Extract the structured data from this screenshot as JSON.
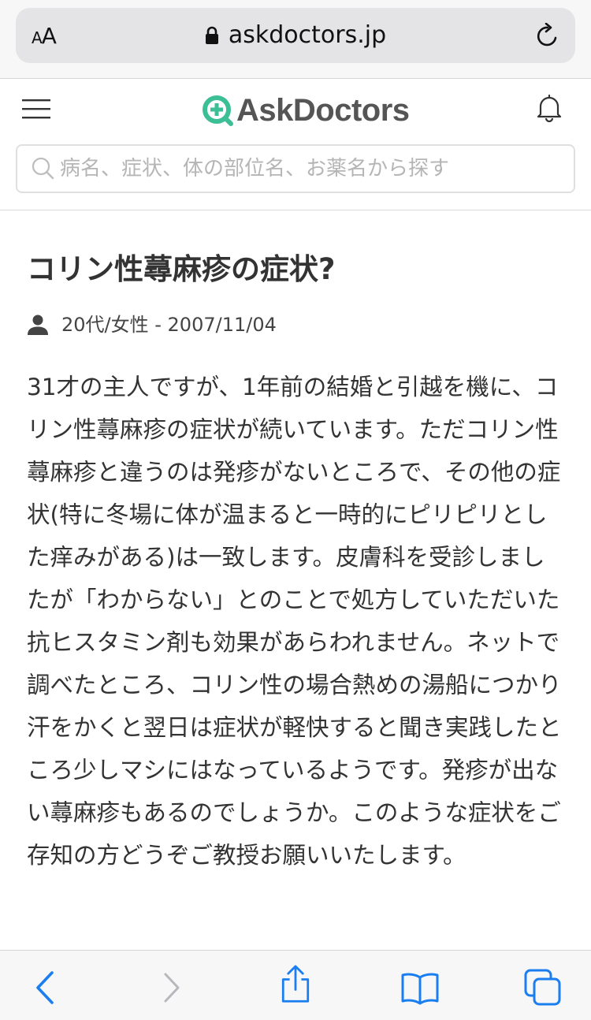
{
  "browser": {
    "aa_small": "A",
    "aa_large": "A",
    "url": "askdoctors.jp"
  },
  "header": {
    "logo_text": "AskDoctors",
    "search_placeholder": "病名、症状、体の部位名、お薬名から探す"
  },
  "question": {
    "title": "コリン性蕁麻疹の症状?",
    "meta": "20代/女性 - 2007/11/04",
    "body": "31才の主人ですが、1年前の結婚と引越を機に、コリン性蕁麻疹の症状が続いています。ただコリン性蕁麻疹と違うのは発疹がないところで、その他の症状(特に冬場に体が温まると一時的にピリピリとした痒みがある)は一致します。皮膚科を受診しましたが「わからない」とのことで処方していただいた抗ヒスタミン剤も効果があらわれません。ネットで調べたところ、コリン性の場合熱めの湯船につかり汗をかくと翌日は症状が軽快すると聞き実践したところ少しマシにはなっているようです。発疹が出ない蕁麻疹もあるのでしょうか。このような症状をご存知の方どうぞご教授お願いいたします。"
  },
  "colors": {
    "brand_green": "#3dbf96",
    "ios_blue": "#1a7ef0",
    "disabled_gray": "#b8b8bc"
  },
  "icons": {
    "menu": "hamburger-icon",
    "bell": "bell-icon",
    "search": "search-icon",
    "lock": "lock-icon",
    "reload": "reload-icon",
    "person": "person-icon"
  }
}
